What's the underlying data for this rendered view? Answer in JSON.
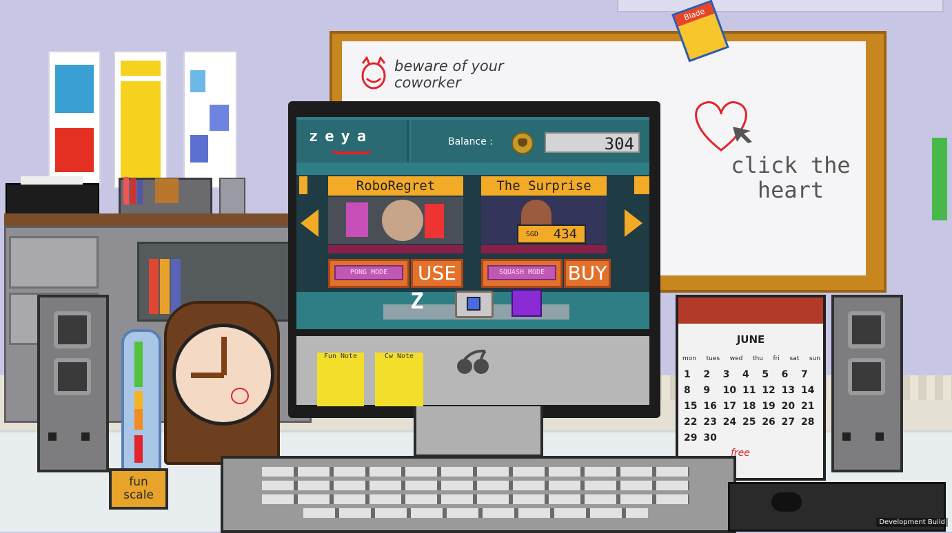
{
  "whiteboard": {
    "warning_line1": "beware of your",
    "warning_line2": "coworker",
    "hint_line1": "click the",
    "hint_line2": "heart"
  },
  "sticker": {
    "text": "Blade"
  },
  "zeya": {
    "logo": "zeya",
    "balance_label": "Balance :",
    "balance_value": "304",
    "games": [
      {
        "title": "RoboRegret",
        "mode_label": "PONG MODE",
        "action_label": "USE"
      },
      {
        "title": "The Surprise",
        "mode_label": "SQUASH MODE",
        "action_label": "BUY",
        "price_currency": "SGD",
        "price_value": "434"
      }
    ],
    "tray_icons": [
      "z-app-icon",
      "folder-box-icon",
      "cherry-bomb-app-icon"
    ]
  },
  "notes": [
    {
      "title": "Fun Note"
    },
    {
      "title": "Cw Note"
    }
  ],
  "fun_scale": {
    "line1": "fun",
    "line2": "scale"
  },
  "calendar": {
    "month": "JUNE",
    "weekdays": [
      "mon",
      "tues",
      "wed",
      "thu",
      "fri",
      "sat",
      "sun"
    ],
    "rows": [
      [
        "1",
        "2",
        "3",
        "4",
        "5",
        "6",
        "7"
      ],
      [
        "8",
        "9",
        "10",
        "11",
        "12",
        "13",
        "14"
      ],
      [
        "15",
        "16",
        "17",
        "18",
        "19",
        "20",
        "21"
      ],
      [
        "22",
        "23",
        "24",
        "25",
        "26",
        "27",
        "28"
      ],
      [
        "29",
        "30",
        "",
        "",
        "",
        "",
        ""
      ]
    ],
    "annotation": "free"
  },
  "footer": {
    "build_label": "Development Build"
  },
  "colors": {
    "screen_bg": "#2f7e86",
    "accent_orange": "#f2aa27",
    "heart_red": "#e3232b"
  }
}
